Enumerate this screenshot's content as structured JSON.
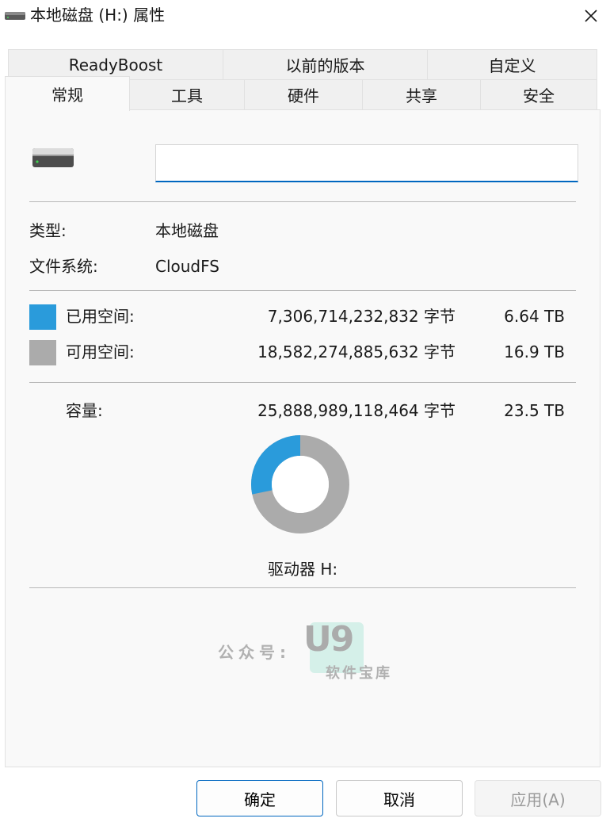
{
  "window": {
    "title": "本地磁盘 (H:) 属性",
    "title_icon": "drive-icon",
    "close_icon": "close-icon"
  },
  "tabs": {
    "row1": [
      {
        "label": "ReadyBoost"
      },
      {
        "label": "以前的版本"
      },
      {
        "label": "自定义"
      }
    ],
    "row2": [
      {
        "label": "常规",
        "active": true
      },
      {
        "label": "工具"
      },
      {
        "label": "硬件"
      },
      {
        "label": "共享"
      },
      {
        "label": "安全"
      }
    ]
  },
  "general": {
    "drive_name_value": "",
    "type_label": "类型:",
    "type_value": "本地磁盘",
    "fs_label": "文件系统:",
    "fs_value": "CloudFS",
    "used": {
      "label": "已用空间:",
      "bytes": "7,306,714,232,832 字节",
      "size": "6.64 TB",
      "color": "#2a9bdb"
    },
    "free": {
      "label": "可用空间:",
      "bytes": "18,582,274,885,632 字节",
      "size": "16.9 TB",
      "color": "#ababab"
    },
    "capacity": {
      "label": "容量:",
      "bytes": "25,888,989,118,464 字节",
      "size": "23.5 TB"
    },
    "used_fraction": 0.2822,
    "drive_label": "驱动器 H:"
  },
  "watermark": {
    "prefix": "公众号:",
    "logo": "U9",
    "sub": "软件宝库"
  },
  "buttons": {
    "ok": "确定",
    "cancel": "取消",
    "apply": "应用(A)"
  }
}
